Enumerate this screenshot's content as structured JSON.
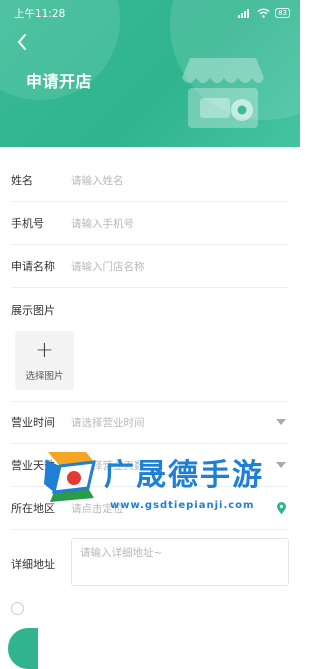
{
  "status_bar": {
    "time": "上午11:28",
    "network": "4G",
    "battery": "83"
  },
  "header": {
    "title": "申请开店"
  },
  "form": {
    "name": {
      "label": "姓名",
      "placeholder": "请输入姓名"
    },
    "phone": {
      "label": "手机号",
      "placeholder": "请输入手机号"
    },
    "store_name": {
      "label": "申请名称",
      "placeholder": "请输入门店名称"
    },
    "images": {
      "label": "展示图片",
      "upload_label": "选择图片",
      "upload_glyph": "+"
    },
    "business_hours": {
      "label": "营业时间",
      "placeholder": "请选择营业时间"
    },
    "business_days": {
      "label": "营业天数",
      "placeholder": "请选择营业天数"
    },
    "region": {
      "label": "所在地区",
      "placeholder": "请点击定位"
    },
    "address": {
      "label": "详细地址",
      "placeholder": "请输入详细地址~"
    }
  },
  "watermark": {
    "brand": "广晟德手游",
    "url": "www.gsdtiepianji.com"
  },
  "colors": {
    "primary": "#2fb48d",
    "watermark": "#1e7fd6"
  }
}
